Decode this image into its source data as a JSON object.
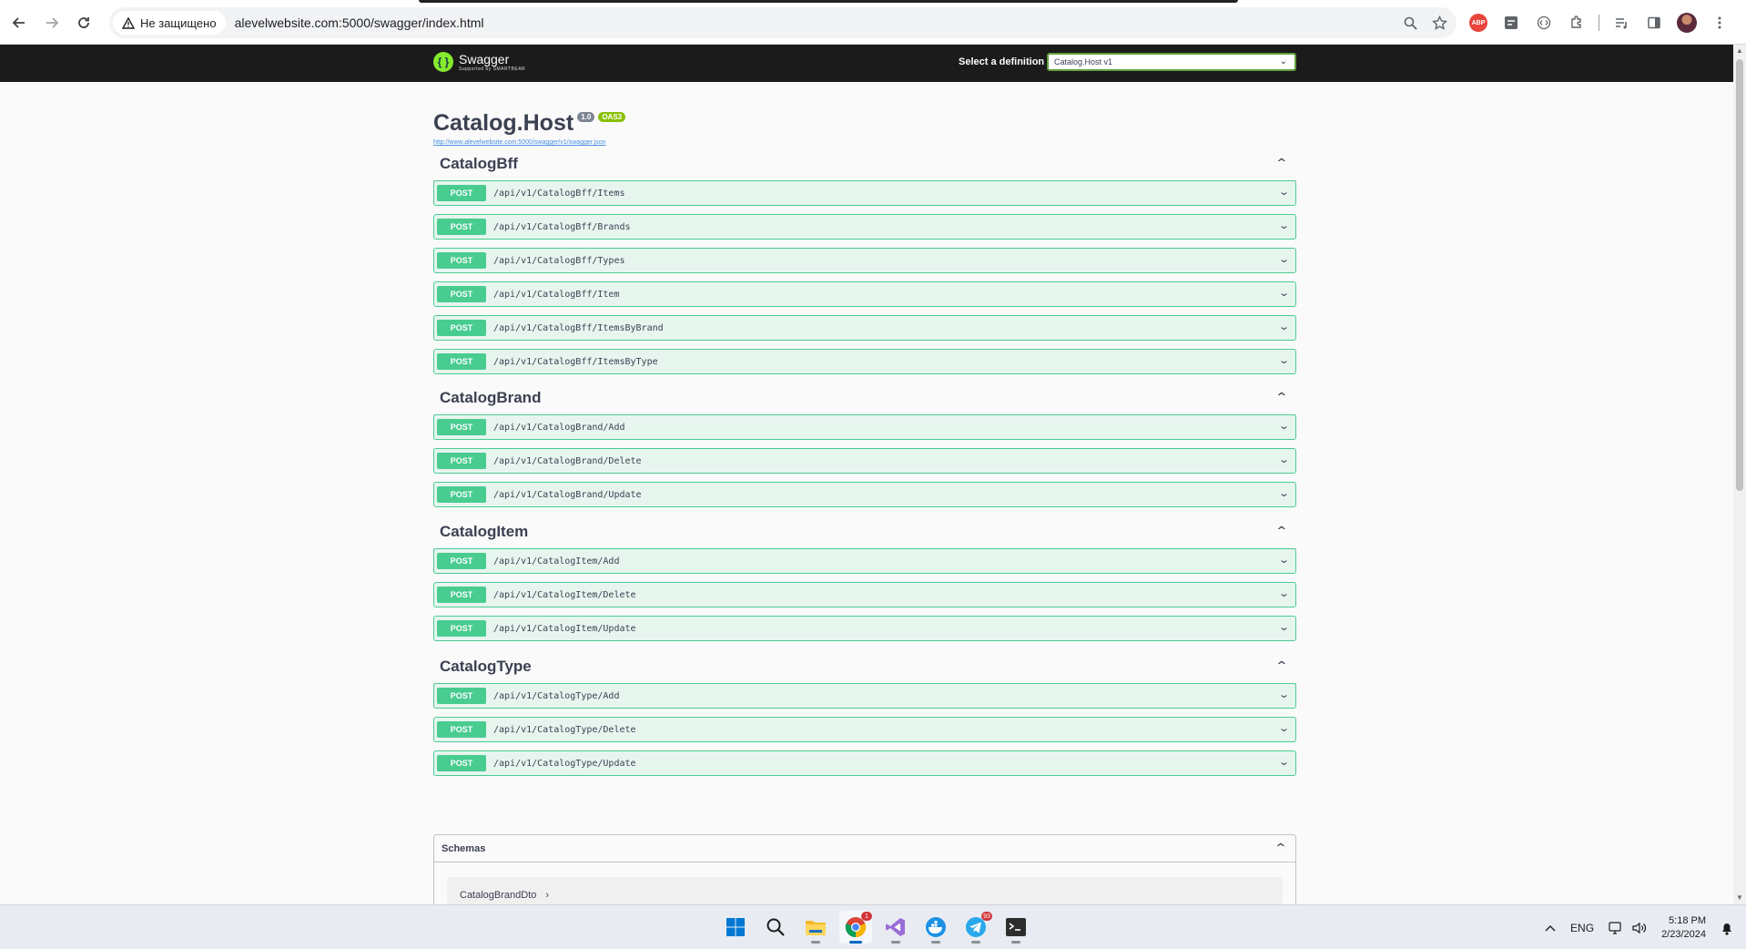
{
  "browser": {
    "security_label": "Не защищено",
    "url": "alevelwebsite.com:5000/swagger/index.html"
  },
  "swagger": {
    "logo_title": "Swagger",
    "logo_sub": "Supported by SMARTBEAR",
    "definition_label": "Select a definition",
    "definition_value": "Catalog.Host v1"
  },
  "info": {
    "title": "Catalog.Host",
    "version": "1.0",
    "oas": "OAS3",
    "spec_url": "http://www.alevelwebsite.com:5000/swagger/v1/swagger.json"
  },
  "tags": [
    {
      "name": "CatalogBff",
      "operations": [
        {
          "method": "POST",
          "path": "/api/v1/CatalogBff/Items"
        },
        {
          "method": "POST",
          "path": "/api/v1/CatalogBff/Brands"
        },
        {
          "method": "POST",
          "path": "/api/v1/CatalogBff/Types"
        },
        {
          "method": "POST",
          "path": "/api/v1/CatalogBff/Item"
        },
        {
          "method": "POST",
          "path": "/api/v1/CatalogBff/ItemsByBrand"
        },
        {
          "method": "POST",
          "path": "/api/v1/CatalogBff/ItemsByType"
        }
      ]
    },
    {
      "name": "CatalogBrand",
      "operations": [
        {
          "method": "POST",
          "path": "/api/v1/CatalogBrand/Add"
        },
        {
          "method": "POST",
          "path": "/api/v1/CatalogBrand/Delete"
        },
        {
          "method": "POST",
          "path": "/api/v1/CatalogBrand/Update"
        }
      ]
    },
    {
      "name": "CatalogItem",
      "operations": [
        {
          "method": "POST",
          "path": "/api/v1/CatalogItem/Add"
        },
        {
          "method": "POST",
          "path": "/api/v1/CatalogItem/Delete"
        },
        {
          "method": "POST",
          "path": "/api/v1/CatalogItem/Update"
        }
      ]
    },
    {
      "name": "CatalogType",
      "operations": [
        {
          "method": "POST",
          "path": "/api/v1/CatalogType/Add"
        },
        {
          "method": "POST",
          "path": "/api/v1/CatalogType/Delete"
        },
        {
          "method": "POST",
          "path": "/api/v1/CatalogType/Update"
        }
      ]
    }
  ],
  "schemas": {
    "title": "Schemas",
    "items": [
      "CatalogBrandDto"
    ]
  },
  "taskbar": {
    "language": "ENG",
    "time": "5:18 PM",
    "date": "2/23/2024",
    "chrome_badge": "1",
    "telegram_badge": "93"
  },
  "colors": {
    "post": "#49cc90",
    "topbar": "#1b1b1b",
    "swagger_green": "#85ea2d"
  }
}
